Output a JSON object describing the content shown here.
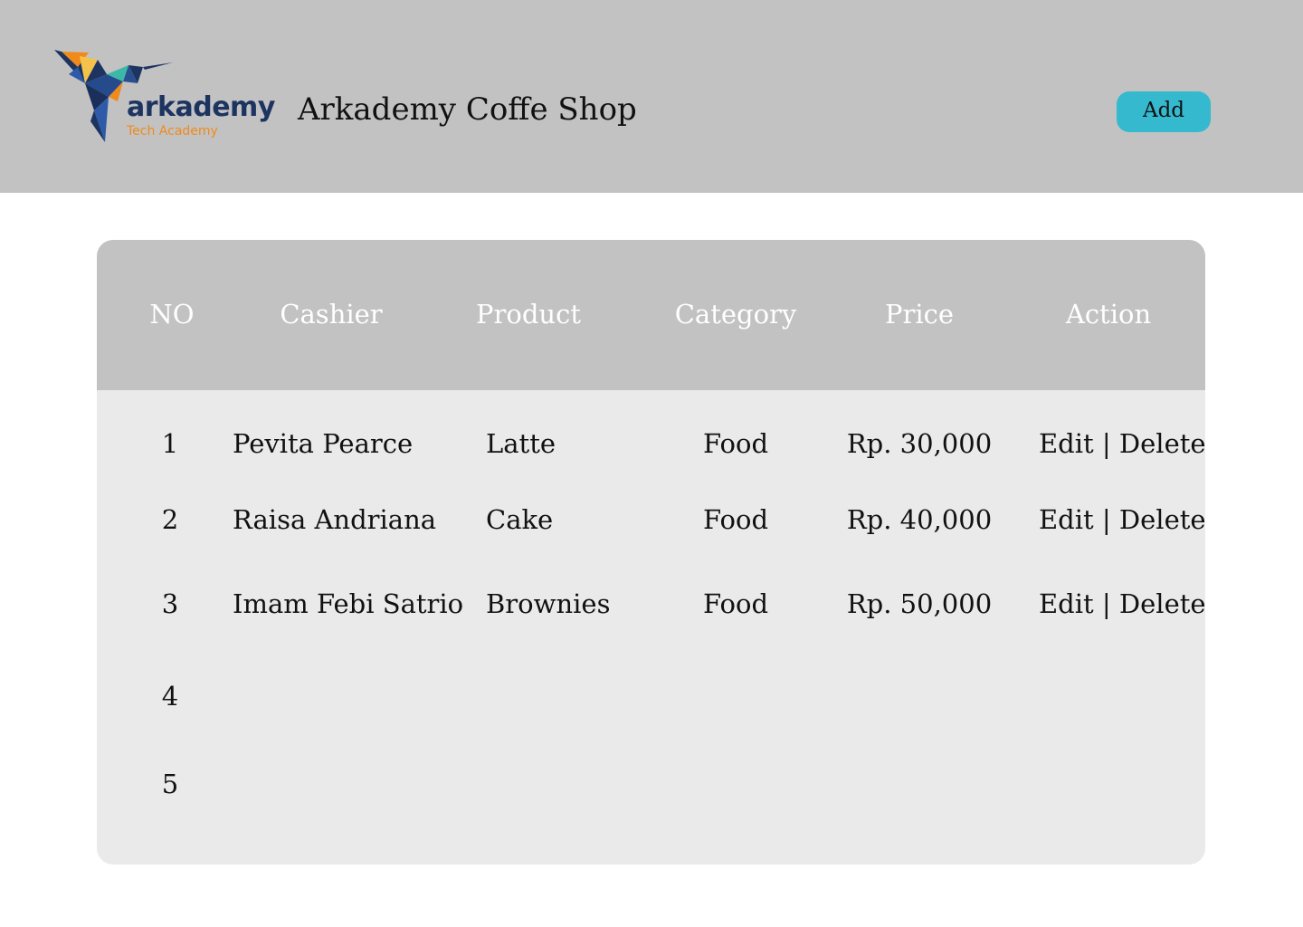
{
  "header": {
    "logo": {
      "word": "arkademy",
      "sub": "Tech Academy",
      "icon": "hummingbird-logo"
    },
    "title": "Arkademy Coffe Shop",
    "add_label": "Add"
  },
  "table": {
    "columns": [
      "NO",
      "Cashier",
      "Product",
      "Category",
      "Price",
      "Action"
    ],
    "rows": [
      {
        "no": "1",
        "cashier": "Pevita Pearce",
        "product": "Latte",
        "category": "Food",
        "price": "Rp. 30,000",
        "edit": "Edit",
        "sep": "|",
        "delete": "Delete"
      },
      {
        "no": "2",
        "cashier": "Raisa Andriana",
        "product": "Cake",
        "category": "Food",
        "price": "Rp. 40,000",
        "edit": "Edit",
        "sep": "|",
        "delete": "Delete"
      },
      {
        "no": "3",
        "cashier": "Imam Febi Satrio",
        "product": "Brownies",
        "category": "Food",
        "price": "Rp. 50,000",
        "edit": "Edit",
        "sep": "|",
        "delete": "Delete"
      },
      {
        "no": "4"
      },
      {
        "no": "5"
      }
    ]
  },
  "colors": {
    "header_bg": "#c2c2c2",
    "add_button": "#34b9cf",
    "table_body": "#eaeaea",
    "logo_navy": "#1d3461",
    "logo_orange": "#f08a1c"
  }
}
